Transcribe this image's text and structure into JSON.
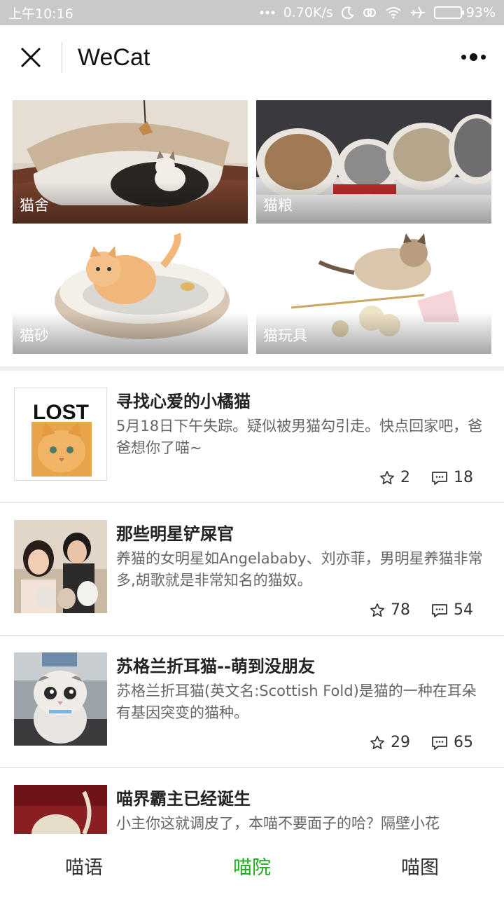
{
  "status_bar": {
    "time": "上午10:16",
    "network_speed": "0.70K/s",
    "battery": "93%",
    "battery_level": 0.93,
    "icons": [
      "more-dots-icon",
      "moon-icon",
      "link-icon",
      "wifi-icon",
      "airplane-icon",
      "battery-icon"
    ]
  },
  "nav": {
    "title": "WeCat",
    "close_icon": "close-icon",
    "more_icon": "more-menu-icon"
  },
  "categories": [
    {
      "label": "猫舍",
      "image": "cat-bed-image"
    },
    {
      "label": "猫粮",
      "image": "cat-food-cans-image"
    },
    {
      "label": "猫砂",
      "image": "cat-litter-box-image"
    },
    {
      "label": "猫玩具",
      "image": "cat-toys-image"
    }
  ],
  "posts": [
    {
      "title": "寻找心爱的小橘猫",
      "description": "5月18日下午失踪。疑似被男猫勾引走。快点回家吧，爸爸想你了喵~",
      "stars": "2",
      "comments": "18",
      "thumb_text": "LOST"
    },
    {
      "title": "那些明星铲屎官",
      "description": "养猫的女明星如Angelababy、刘亦菲，男明星养猫非常多,胡歌就是非常知名的猫奴。",
      "stars": "78",
      "comments": "54"
    },
    {
      "title": "苏格兰折耳猫--萌到没朋友",
      "description": "苏格兰折耳猫(英文名:Scottish Fold)是猫的一种在耳朵有基因突变的猫种。",
      "stars": "29",
      "comments": "65"
    },
    {
      "title": "喵界霸主已经诞生",
      "description": "小主你这就调皮了，本喵不要面子的哈？隔壁小花"
    }
  ],
  "tabs": [
    {
      "label": "喵语",
      "active": false
    },
    {
      "label": "喵院",
      "active": true
    },
    {
      "label": "喵图",
      "active": false
    }
  ],
  "colors": {
    "accent": "#1aad19",
    "status_bar_bg": "#c9c9c9",
    "separator": "#eeeeee"
  }
}
